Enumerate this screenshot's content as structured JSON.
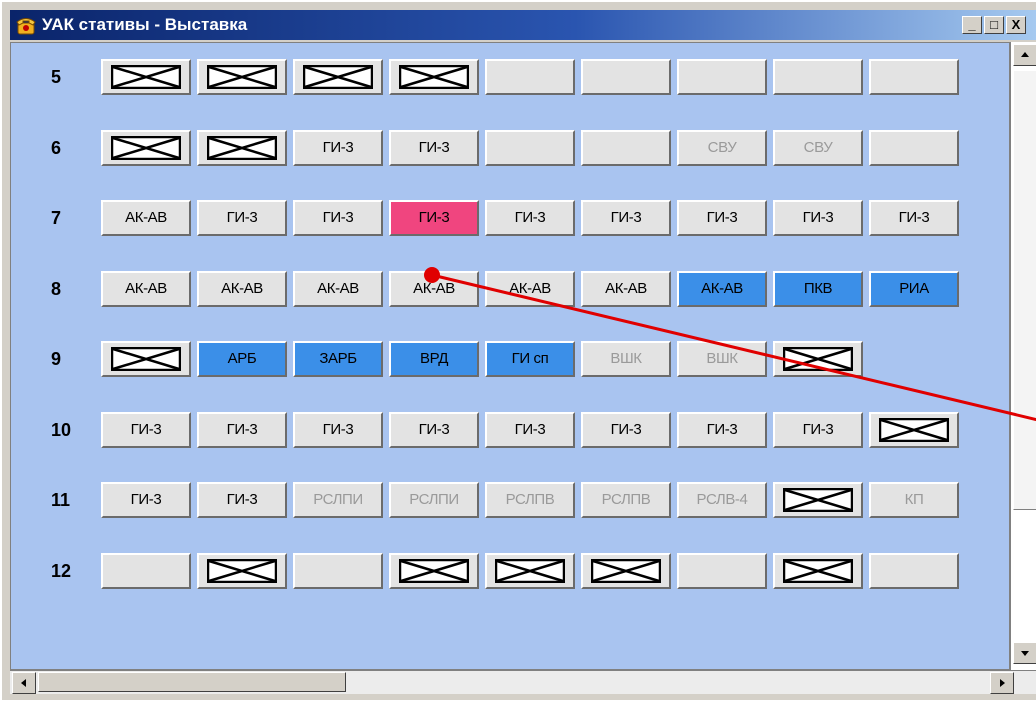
{
  "window": {
    "title": "УАК стативы - Выставка",
    "controls": {
      "minimize": "_",
      "maximize": "□",
      "close": "X"
    }
  },
  "rows": [
    {
      "label": "5",
      "cells": [
        {
          "type": "crossed"
        },
        {
          "type": "crossed"
        },
        {
          "type": "crossed"
        },
        {
          "type": "crossed"
        },
        {
          "type": "blank"
        },
        {
          "type": "blank"
        },
        {
          "type": "blank"
        },
        {
          "type": "blank"
        },
        {
          "type": "blank"
        }
      ]
    },
    {
      "label": "6",
      "cells": [
        {
          "type": "crossed"
        },
        {
          "type": "crossed"
        },
        {
          "type": "text",
          "text": "ГИ-3"
        },
        {
          "type": "text",
          "text": "ГИ-3"
        },
        {
          "type": "blank"
        },
        {
          "type": "blank"
        },
        {
          "type": "text",
          "text": "СВУ",
          "style": "dim"
        },
        {
          "type": "text",
          "text": "СВУ",
          "style": "dim"
        },
        {
          "type": "blank"
        }
      ]
    },
    {
      "label": "7",
      "cells": [
        {
          "type": "text",
          "text": "АК-АВ"
        },
        {
          "type": "text",
          "text": "ГИ-3"
        },
        {
          "type": "text",
          "text": "ГИ-3"
        },
        {
          "type": "text",
          "text": "ГИ-3",
          "style": "pink"
        },
        {
          "type": "text",
          "text": "ГИ-3"
        },
        {
          "type": "text",
          "text": "ГИ-3"
        },
        {
          "type": "text",
          "text": "ГИ-3"
        },
        {
          "type": "text",
          "text": "ГИ-3"
        },
        {
          "type": "text",
          "text": "ГИ-3"
        }
      ]
    },
    {
      "label": "8",
      "cells": [
        {
          "type": "text",
          "text": "АК-АВ"
        },
        {
          "type": "text",
          "text": "АК-АВ"
        },
        {
          "type": "text",
          "text": "АК-АВ"
        },
        {
          "type": "text",
          "text": "АК-АВ"
        },
        {
          "type": "text",
          "text": "АК-АВ"
        },
        {
          "type": "text",
          "text": "АК-АВ"
        },
        {
          "type": "text",
          "text": "АК-АВ",
          "style": "blue"
        },
        {
          "type": "text",
          "text": "ПКВ",
          "style": "blue"
        },
        {
          "type": "text",
          "text": "РИА",
          "style": "blue"
        }
      ]
    },
    {
      "label": "9",
      "cells": [
        {
          "type": "crossed"
        },
        {
          "type": "text",
          "text": "АРБ",
          "style": "blue"
        },
        {
          "type": "text",
          "text": "ЗАРБ",
          "style": "blue"
        },
        {
          "type": "text",
          "text": "ВРД",
          "style": "blue"
        },
        {
          "type": "text",
          "text": "ГИ сп",
          "style": "blue"
        },
        {
          "type": "text",
          "text": "ВШК",
          "style": "dim"
        },
        {
          "type": "text",
          "text": "ВШК",
          "style": "dim"
        },
        {
          "type": "crossed"
        },
        {
          "type": "none"
        }
      ]
    },
    {
      "label": "10",
      "cells": [
        {
          "type": "text",
          "text": "ГИ-3"
        },
        {
          "type": "text",
          "text": "ГИ-3"
        },
        {
          "type": "text",
          "text": "ГИ-3"
        },
        {
          "type": "text",
          "text": "ГИ-3"
        },
        {
          "type": "text",
          "text": "ГИ-3"
        },
        {
          "type": "text",
          "text": "ГИ-3"
        },
        {
          "type": "text",
          "text": "ГИ-3"
        },
        {
          "type": "text",
          "text": "ГИ-3"
        },
        {
          "type": "crossed"
        }
      ]
    },
    {
      "label": "11",
      "cells": [
        {
          "type": "text",
          "text": "ГИ-3"
        },
        {
          "type": "text",
          "text": "ГИ-3"
        },
        {
          "type": "text",
          "text": "РСЛПИ",
          "style": "dim"
        },
        {
          "type": "text",
          "text": "РСЛПИ",
          "style": "dim"
        },
        {
          "type": "text",
          "text": "РСЛПВ",
          "style": "dim"
        },
        {
          "type": "text",
          "text": "РСЛПВ",
          "style": "dim"
        },
        {
          "type": "text",
          "text": "РСЛВ-4",
          "style": "dim"
        },
        {
          "type": "crossed"
        },
        {
          "type": "text",
          "text": "КП",
          "style": "dim"
        }
      ]
    },
    {
      "label": "12",
      "cells": [
        {
          "type": "blank"
        },
        {
          "type": "crossed"
        },
        {
          "type": "blank"
        },
        {
          "type": "crossed"
        },
        {
          "type": "crossed"
        },
        {
          "type": "crossed"
        },
        {
          "type": "blank"
        },
        {
          "type": "crossed"
        },
        {
          "type": "blank"
        }
      ]
    }
  ],
  "colors": {
    "client_bg": "#a9c4f0",
    "cell_bg": "#e3e3e3",
    "active_blue": "#3b8fe8",
    "selected_pink": "#f0457f",
    "disabled_text": "#9a9a9a",
    "annotation": "#e00000"
  },
  "icons": {
    "app": "telephone-icon",
    "crossed_cell": "crossed-box-icon",
    "scroll_up": "arrow-up-icon",
    "scroll_down": "arrow-down-icon",
    "scroll_left": "arrow-left-icon",
    "scroll_right": "arrow-right-icon"
  }
}
